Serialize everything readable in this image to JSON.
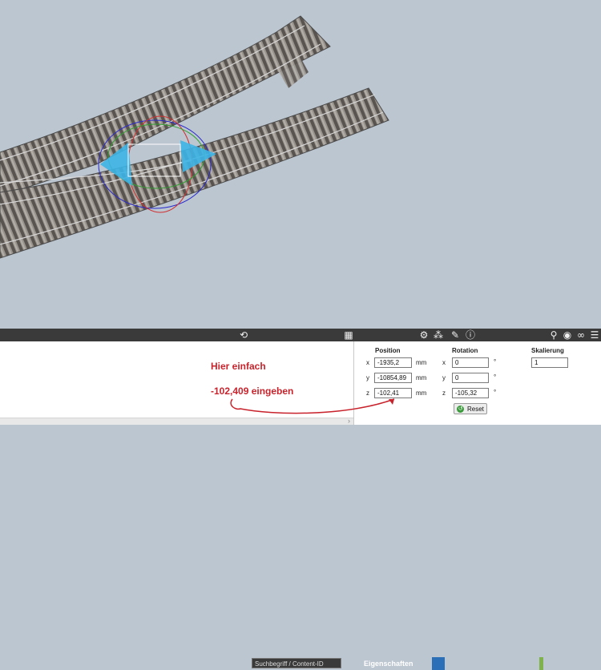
{
  "toolbar": {
    "search_placeholder": "Suchbegriff / Content-ID",
    "tab_properties": "Eigenschaften",
    "icons": [
      "refresh-icon",
      "grid-icon",
      "gear-icon",
      "gizmo-icon",
      "brush-icon",
      "info-icon",
      "pin-icon",
      "eye-icon",
      "link-icon",
      "menu-icon"
    ]
  },
  "annotation": {
    "line1": "Hier einfach",
    "line2": "-102,409 eingeben",
    "color": "#c8232c"
  },
  "properties": {
    "position": {
      "header": "Position",
      "x": {
        "label": "x",
        "value": "-1935,2",
        "unit": "mm"
      },
      "y": {
        "label": "y",
        "value": "-10854,89",
        "unit": "mm"
      },
      "z": {
        "label": "z",
        "value": "-102,41",
        "unit": "mm"
      }
    },
    "rotation": {
      "header": "Rotation",
      "x": {
        "label": "x",
        "value": "0",
        "unit": "°"
      },
      "y": {
        "label": "y",
        "value": "0",
        "unit": "°"
      },
      "z": {
        "label": "z",
        "value": "-105,32",
        "unit": "°"
      }
    },
    "scale": {
      "header": "Skalierung",
      "value": "1"
    },
    "reset_label": "Reset"
  },
  "colors": {
    "viewport_bg": "#bcc6d0",
    "toolbar_bg": "#3a3a3a",
    "active_tab": "#2a6fb8",
    "gizmo_arrow": "#3cb4e6"
  }
}
